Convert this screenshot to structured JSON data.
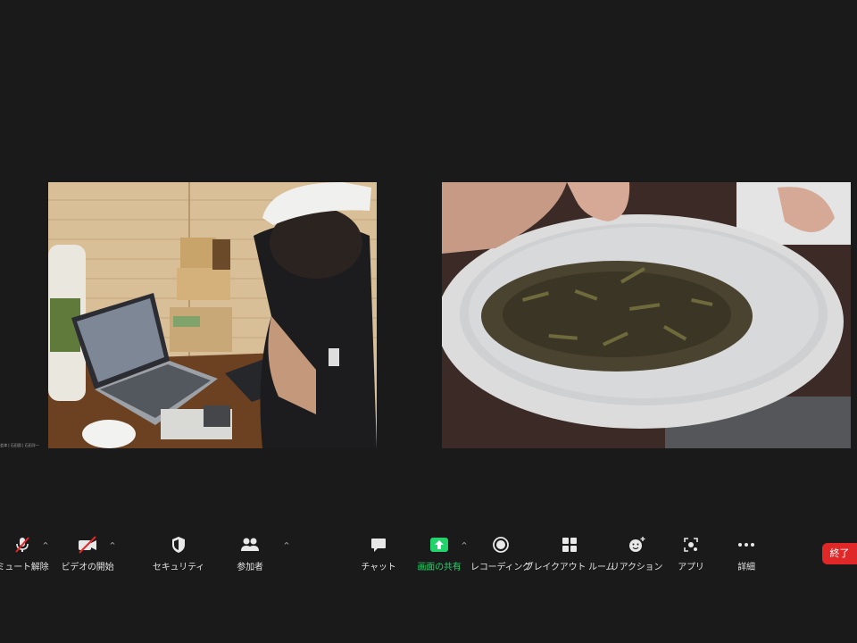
{
  "participants": {
    "left_name": "会津 | 石田園 | 石田洋一"
  },
  "toolbar": {
    "mute_label": "ミュート解除",
    "video_label": "ビデオの開始",
    "security_label": "セキュリティ",
    "participants_label": "参加者",
    "chat_label": "チャット",
    "share_label": "画面の共有",
    "record_label": "レコーディング",
    "breakout_label": "ブレイクアウト ルーム",
    "reactions_label": "リアクション",
    "apps_label": "アプリ",
    "more_label": "詳細",
    "end_label": "終了"
  },
  "colors": {
    "background": "#1a1a1a",
    "share_accent": "#22d36b",
    "muted_red": "#e02828",
    "end_red": "#e02828"
  }
}
